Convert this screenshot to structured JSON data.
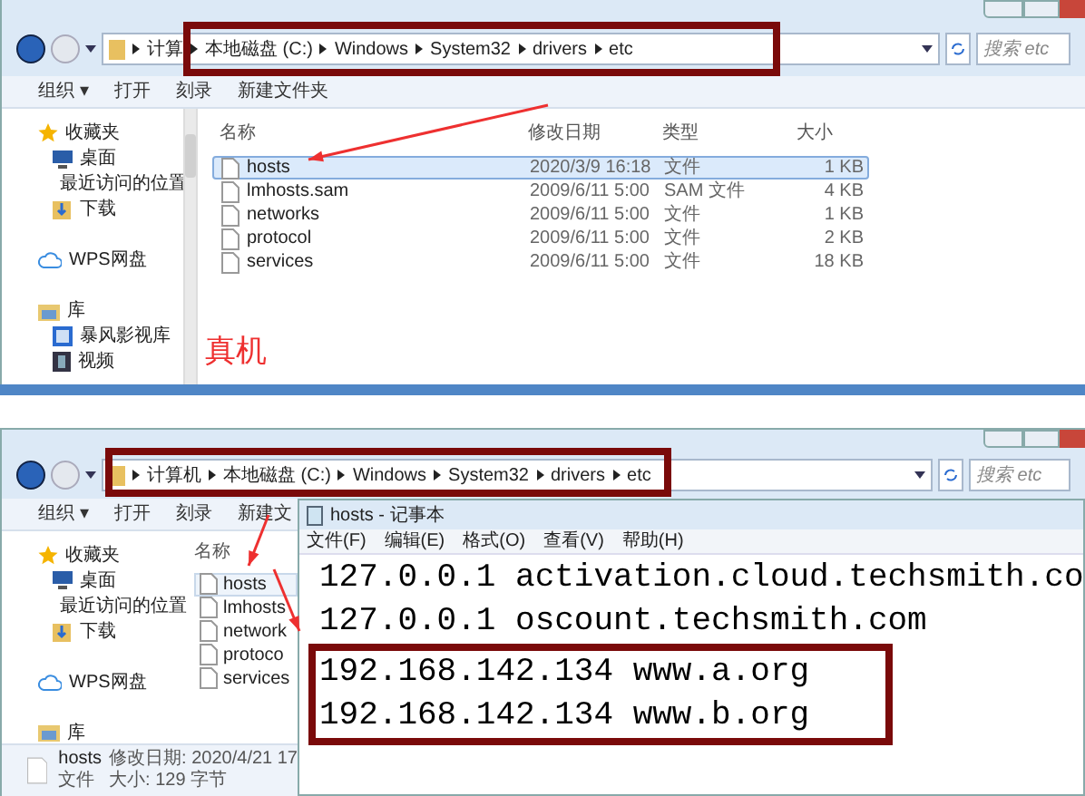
{
  "top_explorer": {
    "breadcrumbs": [
      "计算",
      "本地磁盘 (C:)",
      "Windows",
      "System32",
      "drivers",
      "etc"
    ],
    "search": {
      "placeholder": "搜索 etc"
    },
    "toolbar": [
      "组织 ▾",
      "打开",
      "刻录",
      "新建文件夹"
    ],
    "nav": [
      {
        "label": "收藏夹",
        "kind": "favorites"
      },
      {
        "label": "桌面",
        "kind": "desktop"
      },
      {
        "label": "最近访问的位置",
        "kind": "recent"
      },
      {
        "label": "下载",
        "kind": "downloads"
      },
      {
        "label": "WPS网盘",
        "kind": "cloud"
      },
      {
        "label": "库",
        "kind": "library"
      },
      {
        "label": "暴风影视库",
        "kind": "media"
      },
      {
        "label": "视频",
        "kind": "video"
      }
    ],
    "columns": [
      "名称",
      "修改日期",
      "类型",
      "大小"
    ],
    "files": [
      {
        "name": "hosts",
        "date": "2020/3/9 16:18",
        "type": "文件",
        "size": "1 KB",
        "selected": true
      },
      {
        "name": "lmhosts.sam",
        "date": "2009/6/11 5:00",
        "type": "SAM 文件",
        "size": "4 KB",
        "selected": false
      },
      {
        "name": "networks",
        "date": "2009/6/11 5:00",
        "type": "文件",
        "size": "1 KB",
        "selected": false
      },
      {
        "name": "protocol",
        "date": "2009/6/11 5:00",
        "type": "文件",
        "size": "2 KB",
        "selected": false
      },
      {
        "name": "services",
        "date": "2009/6/11 5:00",
        "type": "文件",
        "size": "18 KB",
        "selected": false
      }
    ],
    "annotation": "真机"
  },
  "bottom_explorer": {
    "breadcrumbs": [
      "计算机",
      "本地磁盘 (C:)",
      "Windows",
      "System32",
      "drivers",
      "etc"
    ],
    "search": {
      "placeholder": "搜索 etc"
    },
    "toolbar": [
      "组织 ▾",
      "打开",
      "刻录",
      "新建文"
    ],
    "nav": [
      {
        "label": "收藏夹",
        "kind": "favorites"
      },
      {
        "label": "桌面",
        "kind": "desktop"
      },
      {
        "label": "最近访问的位置",
        "kind": "recent"
      },
      {
        "label": "下载",
        "kind": "downloads"
      },
      {
        "label": "WPS网盘",
        "kind": "cloud"
      },
      {
        "label": "库",
        "kind": "library"
      }
    ],
    "column": "名称",
    "files": [
      {
        "name": "hosts",
        "selected": true
      },
      {
        "name": "lmhosts",
        "selected": false
      },
      {
        "name": "network",
        "selected": false
      },
      {
        "name": "protoco",
        "selected": false
      },
      {
        "name": "services",
        "selected": false
      }
    ],
    "details": {
      "name": "hosts",
      "date_label": "修改日期:",
      "date": "2020/4/21 17",
      "type": "文件",
      "size_label": "大小:",
      "size": "129 字节"
    }
  },
  "notepad": {
    "title": "hosts - 记事本",
    "menu": [
      "文件(F)",
      "编辑(E)",
      "格式(O)",
      "查看(V)",
      "帮助(H)"
    ],
    "lines": [
      {
        "text": "127.0.0.1 activation.cloud.techsmith.co",
        "highlighted": false
      },
      {
        "text": "127.0.0.1 oscount.techsmith.com",
        "highlighted": false
      },
      {
        "text": "192.168.142.134 www.a.org",
        "highlighted": true
      },
      {
        "text": "192.168.142.134 www.b.org",
        "highlighted": true
      }
    ]
  }
}
